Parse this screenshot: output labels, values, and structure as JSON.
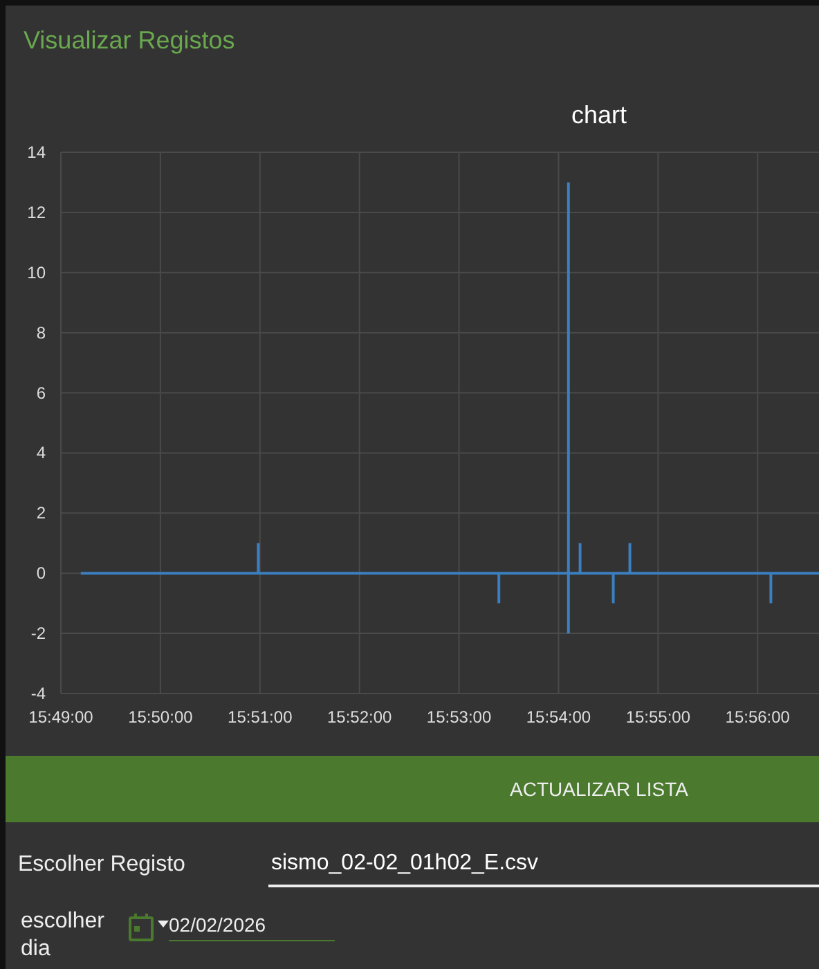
{
  "title": "Visualizar Registos",
  "chart": {
    "chart_data": {
      "type": "line",
      "title": "chart",
      "x": [
        56952,
        57059,
        57059,
        57059,
        57204,
        57204,
        57204,
        57246,
        57246,
        57246,
        57246,
        57253,
        57253,
        57253,
        57273,
        57273,
        57273,
        57283,
        57283,
        57283,
        57368,
        57368,
        57368,
        57397
      ],
      "xlim": [
        56940,
        57397
      ],
      "grid": true,
      "series": [
        {
          "color": "#3b7fc0",
          "values": [
            0,
            0,
            1,
            0,
            0,
            -1,
            0,
            0,
            13,
            -2,
            0,
            0,
            1,
            0,
            0,
            -1,
            0,
            0,
            1,
            0,
            0,
            -1,
            0,
            0
          ]
        }
      ],
      "ylim": [
        -4,
        14
      ],
      "yticks": [
        -4,
        -2,
        0,
        2,
        4,
        6,
        8,
        10,
        12,
        14
      ],
      "xticks": [
        {
          "value": 56940,
          "label": "15:49:00"
        },
        {
          "value": 57000,
          "label": "15:50:00"
        },
        {
          "value": 57060,
          "label": "15:51:00"
        },
        {
          "value": 57120,
          "label": "15:52:00"
        },
        {
          "value": 57180,
          "label": "15:53:00"
        },
        {
          "value": 57240,
          "label": "15:54:00"
        },
        {
          "value": 57300,
          "label": "15:55:00"
        },
        {
          "value": 57360,
          "label": "15:56:00"
        }
      ]
    }
  },
  "refresh_button": {
    "label": "ACTUALIZAR LISTA"
  },
  "record_select": {
    "label": "Escolher Registo",
    "value": "sismo_02-02_01h02_E.csv"
  },
  "day_picker": {
    "label": "escolher dia",
    "value": "02/02/2026"
  }
}
